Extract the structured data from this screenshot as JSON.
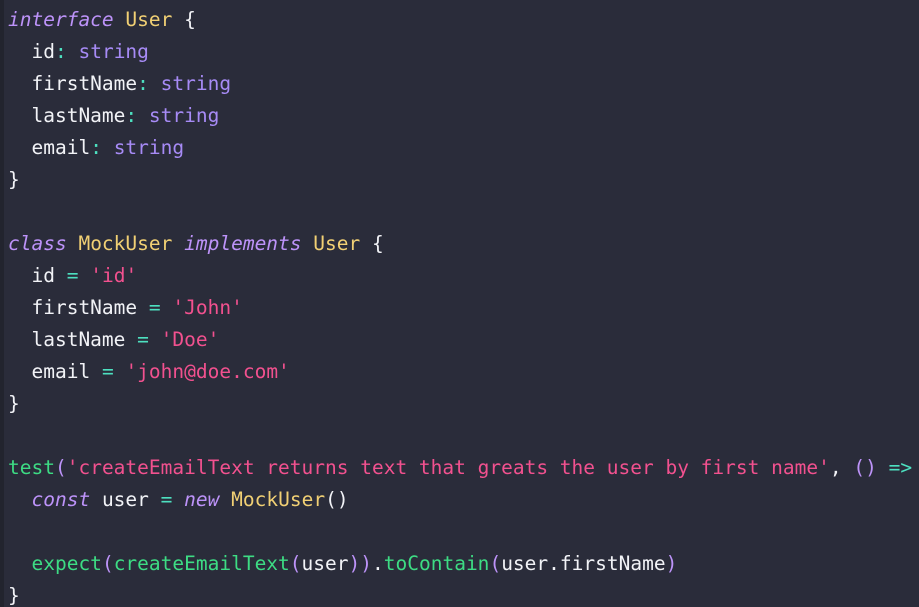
{
  "editor": {
    "background_color": "#2a2c3a",
    "gutter_color": "#22242e",
    "language": "typescript",
    "font_size_px": 19.5,
    "line_height_px": 32
  },
  "palette": {
    "keyword": "#bd93f9",
    "type_name": "#f1d074",
    "builtin_type": "#a78bf6",
    "string": "#f2518f",
    "function": "#3ddc84",
    "operator": "#4de0c0",
    "punctuation": "#f2f3f7",
    "identifier": "#f2f3f7"
  },
  "code": {
    "lines": [
      {
        "n": 1,
        "tokens": [
          {
            "t": "interface",
            "c": "kw"
          },
          {
            "t": " ",
            "c": "punc"
          },
          {
            "t": "User",
            "c": "typ"
          },
          {
            "t": " ",
            "c": "punc"
          },
          {
            "t": "{",
            "c": "punc"
          }
        ]
      },
      {
        "n": 2,
        "tokens": [
          {
            "t": "  ",
            "c": "punc"
          },
          {
            "t": "id",
            "c": "prop"
          },
          {
            "t": ":",
            "c": "op"
          },
          {
            "t": " ",
            "c": "punc"
          },
          {
            "t": "string",
            "c": "type"
          }
        ]
      },
      {
        "n": 3,
        "tokens": [
          {
            "t": "  ",
            "c": "punc"
          },
          {
            "t": "firstName",
            "c": "prop"
          },
          {
            "t": ":",
            "c": "op"
          },
          {
            "t": " ",
            "c": "punc"
          },
          {
            "t": "string",
            "c": "type"
          }
        ]
      },
      {
        "n": 4,
        "tokens": [
          {
            "t": "  ",
            "c": "punc"
          },
          {
            "t": "lastName",
            "c": "prop"
          },
          {
            "t": ":",
            "c": "op"
          },
          {
            "t": " ",
            "c": "punc"
          },
          {
            "t": "string",
            "c": "type"
          }
        ]
      },
      {
        "n": 5,
        "tokens": [
          {
            "t": "  ",
            "c": "punc"
          },
          {
            "t": "email",
            "c": "prop"
          },
          {
            "t": ":",
            "c": "op"
          },
          {
            "t": " ",
            "c": "punc"
          },
          {
            "t": "string",
            "c": "type"
          }
        ]
      },
      {
        "n": 6,
        "tokens": [
          {
            "t": "}",
            "c": "punc"
          }
        ]
      },
      {
        "n": 7,
        "tokens": []
      },
      {
        "n": 8,
        "tokens": [
          {
            "t": "class",
            "c": "kw"
          },
          {
            "t": " ",
            "c": "punc"
          },
          {
            "t": "MockUser",
            "c": "typ"
          },
          {
            "t": " ",
            "c": "punc"
          },
          {
            "t": "implements",
            "c": "kw"
          },
          {
            "t": " ",
            "c": "punc"
          },
          {
            "t": "User",
            "c": "typ"
          },
          {
            "t": " ",
            "c": "punc"
          },
          {
            "t": "{",
            "c": "punc"
          }
        ]
      },
      {
        "n": 9,
        "tokens": [
          {
            "t": "  ",
            "c": "punc"
          },
          {
            "t": "id",
            "c": "prop"
          },
          {
            "t": " ",
            "c": "punc"
          },
          {
            "t": "=",
            "c": "op"
          },
          {
            "t": " ",
            "c": "punc"
          },
          {
            "t": "'id'",
            "c": "str"
          }
        ]
      },
      {
        "n": 10,
        "tokens": [
          {
            "t": "  ",
            "c": "punc"
          },
          {
            "t": "firstName",
            "c": "prop"
          },
          {
            "t": " ",
            "c": "punc"
          },
          {
            "t": "=",
            "c": "op"
          },
          {
            "t": " ",
            "c": "punc"
          },
          {
            "t": "'John'",
            "c": "str"
          }
        ]
      },
      {
        "n": 11,
        "tokens": [
          {
            "t": "  ",
            "c": "punc"
          },
          {
            "t": "lastName",
            "c": "prop"
          },
          {
            "t": " ",
            "c": "punc"
          },
          {
            "t": "=",
            "c": "op"
          },
          {
            "t": " ",
            "c": "punc"
          },
          {
            "t": "'Doe'",
            "c": "str"
          }
        ]
      },
      {
        "n": 12,
        "tokens": [
          {
            "t": "  ",
            "c": "punc"
          },
          {
            "t": "email",
            "c": "prop"
          },
          {
            "t": " ",
            "c": "punc"
          },
          {
            "t": "=",
            "c": "op"
          },
          {
            "t": " ",
            "c": "punc"
          },
          {
            "t": "'john@doe.com'",
            "c": "str"
          }
        ]
      },
      {
        "n": 13,
        "tokens": [
          {
            "t": "}",
            "c": "punc"
          }
        ]
      },
      {
        "n": 14,
        "tokens": []
      },
      {
        "n": 15,
        "tokens": [
          {
            "t": "test",
            "c": "fn"
          },
          {
            "t": "(",
            "c": "paren"
          },
          {
            "t": "'createEmailText returns text that greats the user by first name'",
            "c": "str"
          },
          {
            "t": ",",
            "c": "punc"
          },
          {
            "t": " ",
            "c": "punc"
          },
          {
            "t": "(",
            "c": "paren"
          },
          {
            "t": ")",
            "c": "paren"
          },
          {
            "t": " ",
            "c": "punc"
          },
          {
            "t": "=>",
            "c": "op"
          }
        ]
      },
      {
        "n": 16,
        "tokens": [
          {
            "t": "  ",
            "c": "punc"
          },
          {
            "t": "const",
            "c": "kw"
          },
          {
            "t": " ",
            "c": "punc"
          },
          {
            "t": "user",
            "c": "id"
          },
          {
            "t": " ",
            "c": "punc"
          },
          {
            "t": "=",
            "c": "op"
          },
          {
            "t": " ",
            "c": "punc"
          },
          {
            "t": "new",
            "c": "kw"
          },
          {
            "t": " ",
            "c": "punc"
          },
          {
            "t": "MockUser",
            "c": "typ"
          },
          {
            "t": "(",
            "c": "punc"
          },
          {
            "t": ")",
            "c": "punc"
          }
        ]
      },
      {
        "n": 17,
        "tokens": []
      },
      {
        "n": 18,
        "tokens": [
          {
            "t": "  ",
            "c": "punc"
          },
          {
            "t": "expect",
            "c": "fn"
          },
          {
            "t": "(",
            "c": "paren"
          },
          {
            "t": "createEmailText",
            "c": "fn"
          },
          {
            "t": "(",
            "c": "paren"
          },
          {
            "t": "user",
            "c": "id"
          },
          {
            "t": ")",
            "c": "paren"
          },
          {
            "t": ")",
            "c": "paren"
          },
          {
            "t": ".",
            "c": "punc"
          },
          {
            "t": "toContain",
            "c": "fn"
          },
          {
            "t": "(",
            "c": "paren"
          },
          {
            "t": "user",
            "c": "id"
          },
          {
            "t": ".",
            "c": "punc"
          },
          {
            "t": "firstName",
            "c": "id"
          },
          {
            "t": ")",
            "c": "paren"
          }
        ]
      },
      {
        "n": 19,
        "tokens": [
          {
            "t": "}",
            "c": "punc"
          }
        ]
      }
    ],
    "plain_text": "interface User {\n  id: string\n  firstName: string\n  lastName: string\n  email: string\n}\n\nclass MockUser implements User {\n  id = 'id'\n  firstName = 'John'\n  lastName = 'Doe'\n  email = 'john@doe.com'\n}\n\ntest('createEmailText returns text that greats the user by first name', () =>\n  const user = new MockUser()\n\n  expect(createEmailText(user)).toContain(user.firstName)\n}"
  }
}
